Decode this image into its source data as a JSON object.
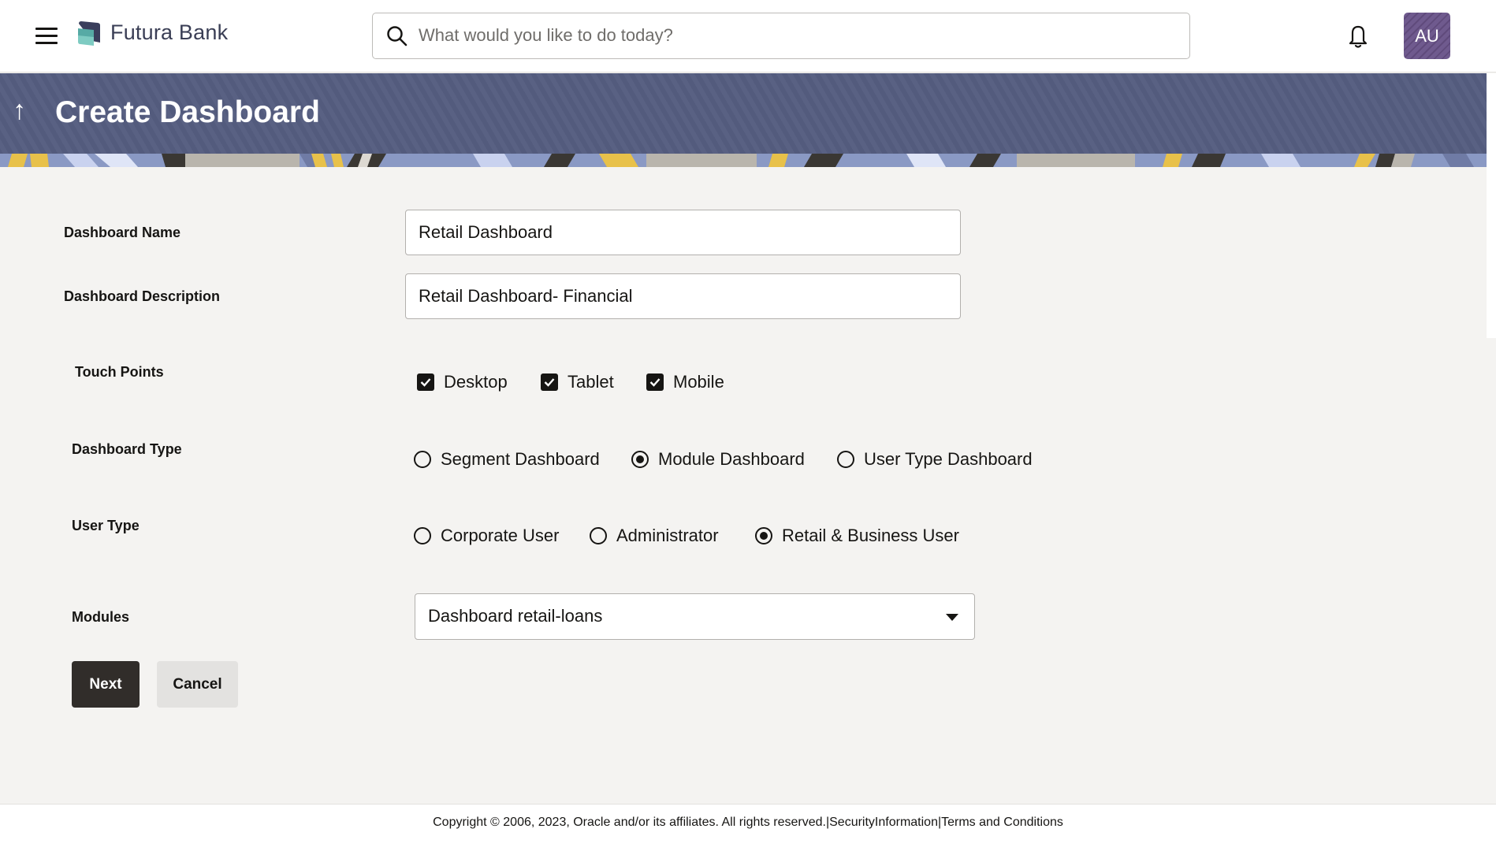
{
  "header": {
    "brand": "Futura Bank",
    "search_placeholder": "What would you like to do today?",
    "avatar_initials": "AU",
    "icons": {
      "menu": "hamburger-menu-icon",
      "search": "search-icon",
      "notifications": "bell-icon"
    }
  },
  "banner": {
    "title": "Create Dashboard",
    "back_icon": "↑"
  },
  "form": {
    "dashboard_name": {
      "label": "Dashboard Name",
      "value": "Retail Dashboard"
    },
    "dashboard_description": {
      "label": "Dashboard Description",
      "value": "Retail Dashboard- Financial"
    },
    "touch_points": {
      "label": "Touch Points",
      "options": [
        {
          "label": "Desktop",
          "checked": true
        },
        {
          "label": "Tablet",
          "checked": true
        },
        {
          "label": "Mobile",
          "checked": true
        }
      ]
    },
    "dashboard_type": {
      "label": "Dashboard Type",
      "options": [
        {
          "label": "Segment Dashboard",
          "selected": false
        },
        {
          "label": "Module Dashboard",
          "selected": true
        },
        {
          "label": "User Type Dashboard",
          "selected": false
        }
      ]
    },
    "user_type": {
      "label": "User Type",
      "options": [
        {
          "label": "Corporate User",
          "selected": false
        },
        {
          "label": "Administrator",
          "selected": false
        },
        {
          "label": "Retail & Business User",
          "selected": true
        }
      ]
    },
    "modules": {
      "label": "Modules",
      "selected": "Dashboard retail-loans"
    }
  },
  "actions": {
    "next_label": "Next",
    "cancel_label": "Cancel"
  },
  "footer": {
    "copyright": "Copyright © 2006, 2023, Oracle and/or its affiliates. All rights reserved.",
    "separator": "|",
    "security_link": "SecurityInformation",
    "terms_link": "Terms and Conditions"
  }
}
